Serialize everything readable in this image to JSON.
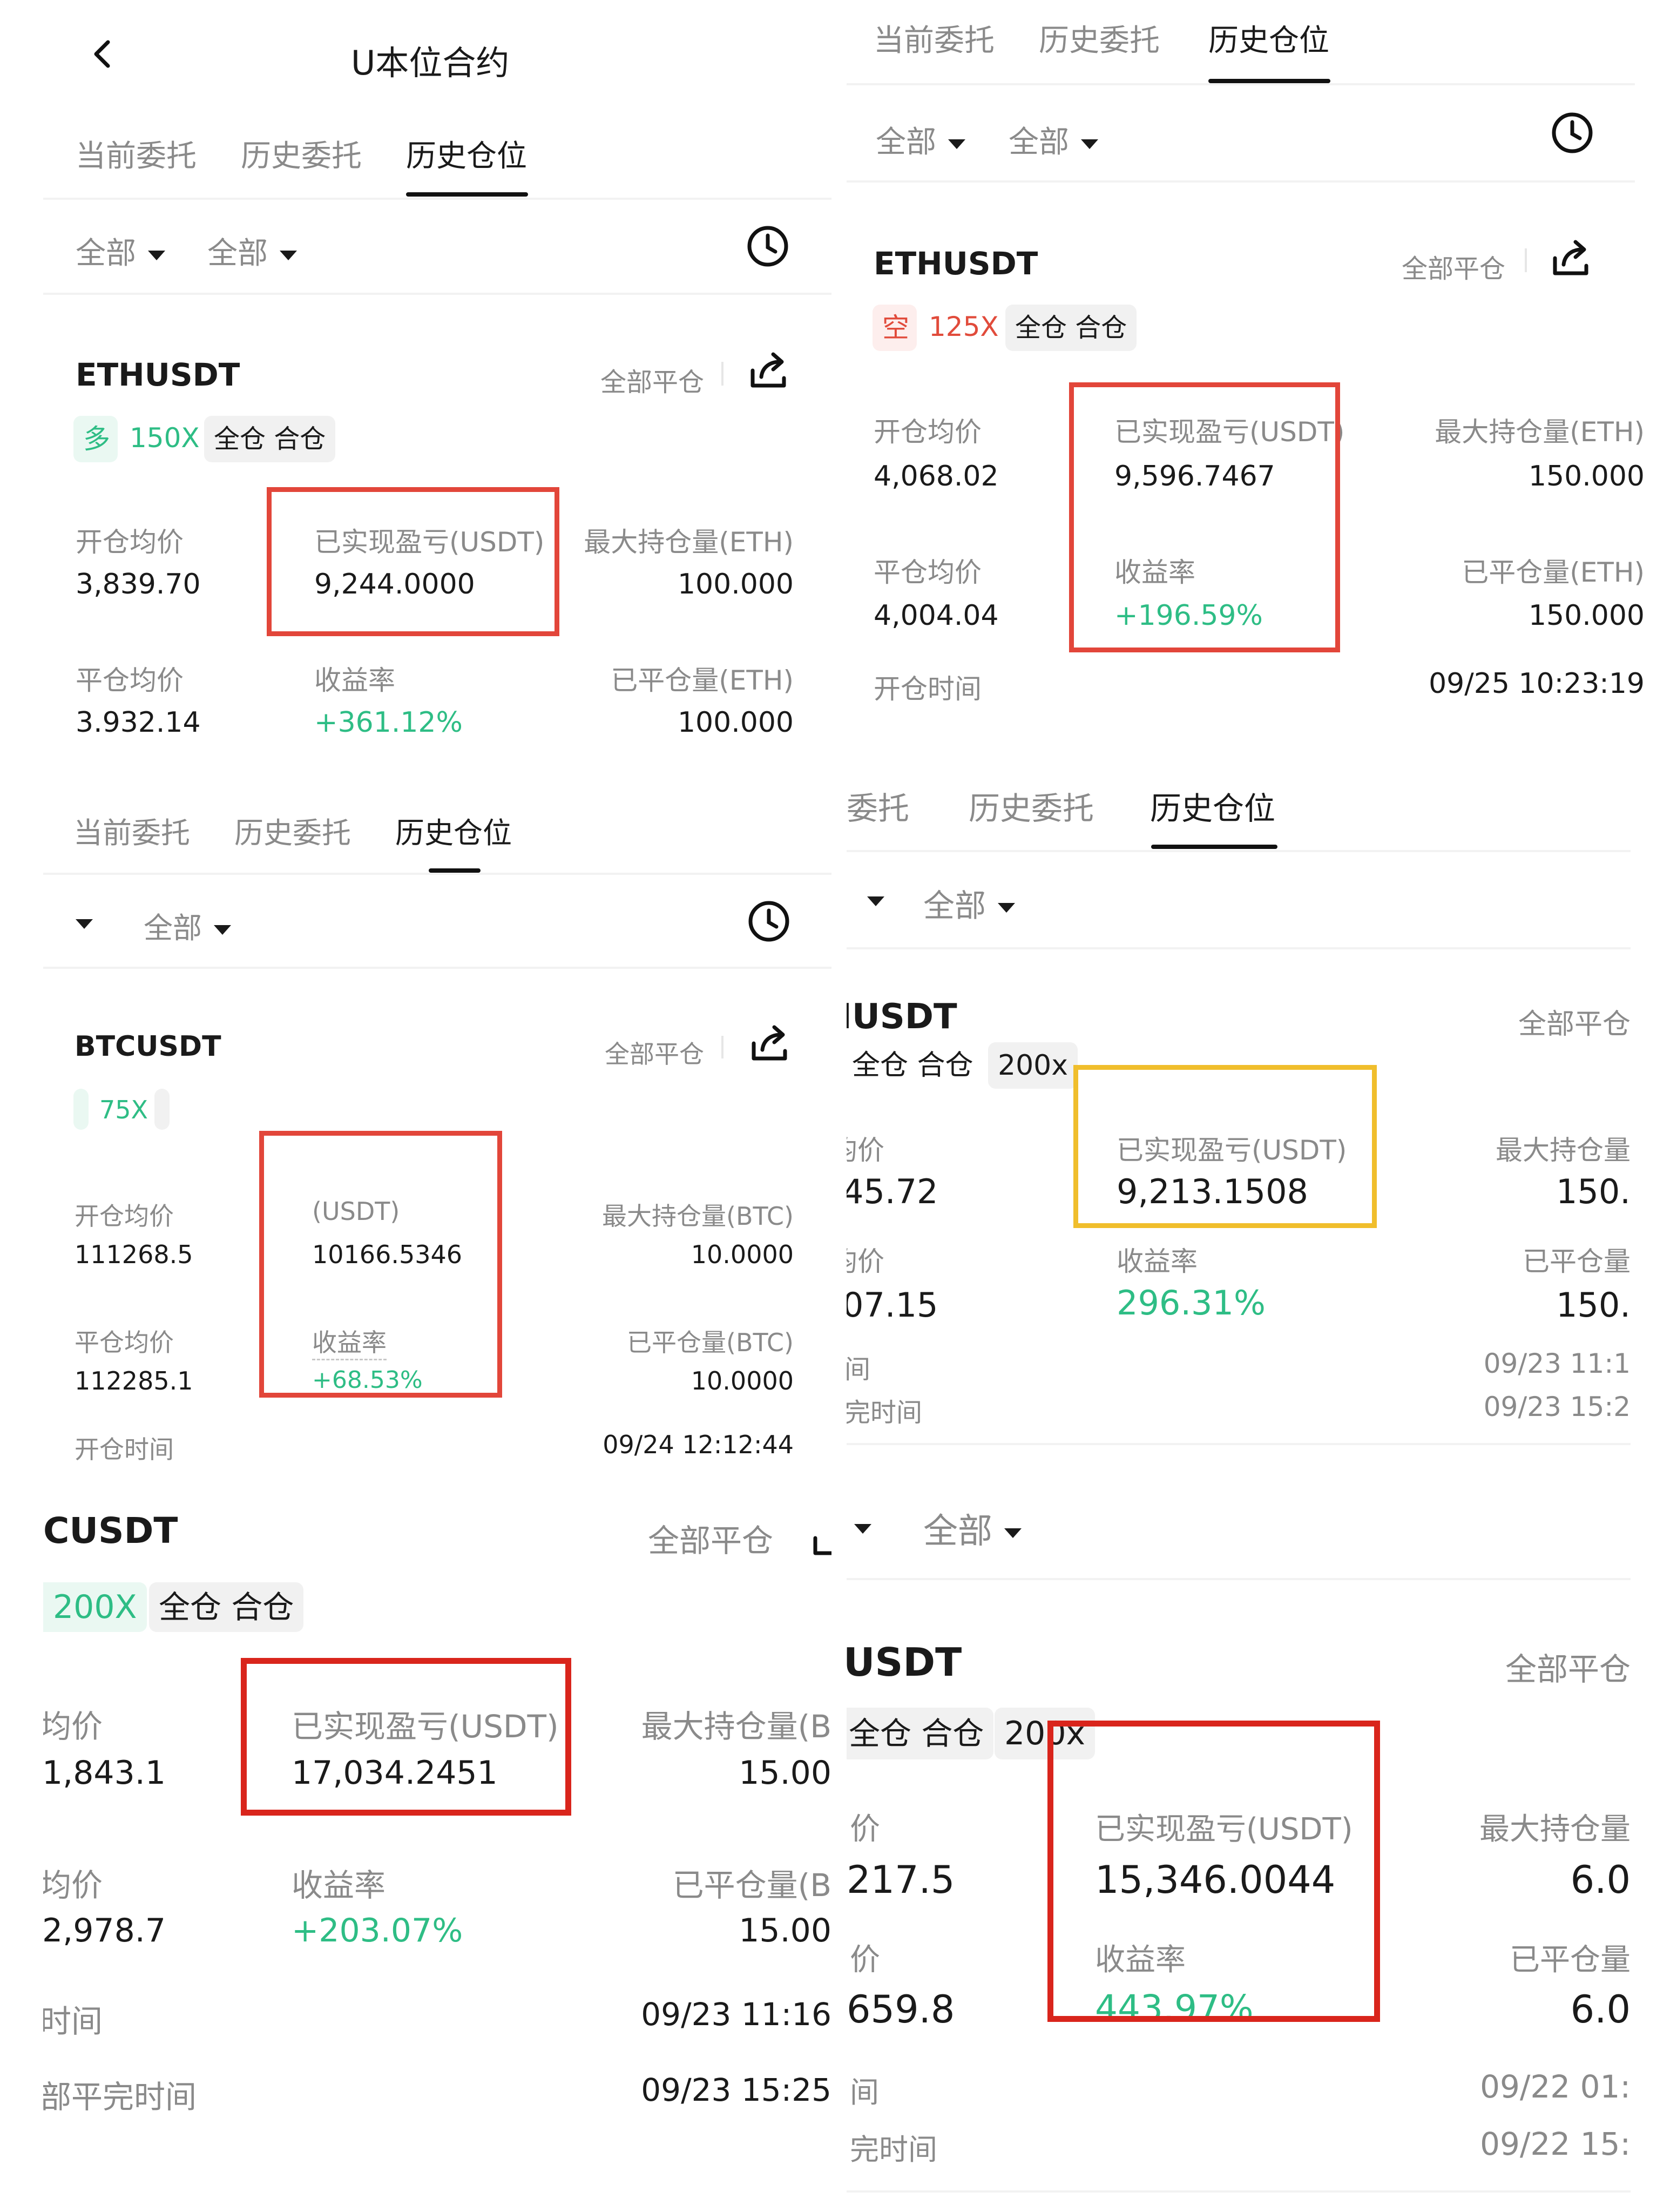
{
  "p1": {
    "title": "U本位合约",
    "tabs": [
      "当前委托",
      "历史委托",
      "历史仓位"
    ],
    "filter1": "全部",
    "filter2": "全部",
    "symbol": "ETHUSDT",
    "close_all": "全部平仓",
    "side": "多",
    "leverage": "150X",
    "margin": "全仓 合仓",
    "open_avg_label": "开仓均价",
    "open_avg": "3,839.70",
    "pnl_label": "已实现盈亏(USDT)",
    "pnl": "9,244.0000",
    "max_hold_label": "最大持仓量(ETH)",
    "max_hold": "100.000",
    "close_avg_label": "平仓均价",
    "close_avg": "3.932.14",
    "roi_label": "收益率",
    "roi": "+361.12%",
    "closed_label": "已平仓量(ETH)",
    "closed": "100.000"
  },
  "p2": {
    "tabs_partial": "当前委托",
    "tabs": [
      "历史委托",
      "历史仓位"
    ],
    "filter1": "全部",
    "filter2": "全部",
    "symbol": "ETHUSDT",
    "close_all": "全部平仓",
    "side": "空",
    "leverage": "125X",
    "margin": "全仓 合仓",
    "open_avg_label": "开仓均价",
    "open_avg": "4,068.02",
    "pnl_label": "已实现盈亏(USDT)",
    "pnl": "9,596.7467",
    "max_hold_label": "最大持仓量(ETH)",
    "max_hold": "150.000",
    "close_avg_label": "平仓均价",
    "close_avg": "4,004.04",
    "roi_label": "收益率",
    "roi": "+196.59%",
    "closed_label": "已平仓量(ETH)",
    "closed": "150.000",
    "open_time_label": "开仓时间",
    "open_time": "09/25 10:23:19"
  },
  "p3": {
    "tabs": [
      "当前委托",
      "历史委托",
      "历史仓位"
    ],
    "filter2": "全部",
    "symbol": "BTCUSDT",
    "close_all": "全部平仓",
    "leverage": "75X",
    "open_avg_label": "开仓均价",
    "open_avg": "111268.5",
    "pnl_label": "(USDT)",
    "pnl": "10166.5346",
    "max_hold_label": "最大持仓量(BTC)",
    "max_hold": "10.0000",
    "close_avg_label": "平仓均价",
    "close_avg": "112285.1",
    "roi_label": "收益率",
    "roi": "+68.53%",
    "closed_label": "已平仓量(BTC)",
    "closed": "10.0000",
    "open_time_label": "开仓时间",
    "open_time": "09/24 12:12:44"
  },
  "p4": {
    "tabs": [
      "委托",
      "历史委托",
      "历史仓位"
    ],
    "filter2": "全部",
    "symbol": "IUSDT",
    "close_all": "全部平仓",
    "margin": "全仓 合仓",
    "leverage": "200x",
    "open_avg_label": "均价",
    "open_avg": "45.72",
    "pnl_label": "已实现盈亏(USDT)",
    "pnl": "9,213.1508",
    "max_hold_label": "最大持仓量",
    "max_hold": "150.",
    "close_avg_label": "均价",
    "close_avg": "07.15",
    "roi_label": "收益率",
    "roi": "296.31%",
    "closed_label": "已平仓量",
    "closed": "150.",
    "open_time_label": "间",
    "open_time": "09/23 11:1",
    "close_time_label": "完时间",
    "close_time": "09/23 15:2"
  },
  "p5": {
    "symbol": "CUSDT",
    "close_all": "全部平仓",
    "leverage": "200X",
    "margin": "全仓 合仓",
    "open_avg_label": "均价",
    "open_avg": "1,843.1",
    "pnl_label": "已实现盈亏(USDT)",
    "pnl": "17,034.2451",
    "max_hold_label": "最大持仓量(B",
    "max_hold": "15.00",
    "close_avg_label": "均价",
    "close_avg": "2,978.7",
    "roi_label": "收益率",
    "roi": "+203.07%",
    "closed_label": "已平仓量(B",
    "closed": "15.00",
    "open_time_label": "时间",
    "open_time": "09/23 11:16",
    "close_time_label": "部平完时间",
    "close_time": "09/23 15:25"
  },
  "p6": {
    "filter2": "全部",
    "symbol": "USDT",
    "close_all": "全部平仓",
    "margin": "全仓 合仓",
    "leverage": "200x",
    "open_avg_label": "价",
    "open_avg": "217.5",
    "pnl_label": "已实现盈亏(USDT)",
    "pnl": "15,346.0044",
    "max_hold_label": "最大持仓量",
    "max_hold": "6.0",
    "close_avg_label": "价",
    "close_avg": "659.8",
    "roi_label": "收益率",
    "roi": "443.97%",
    "closed_label": "已平仓量",
    "closed": "6.0",
    "open_time_label": "间",
    "open_time": "09/22 01:",
    "close_time_label": "完时间",
    "close_time": "09/22 15:"
  },
  "colors": {
    "profit_green": "#2ebd85",
    "short_red": "#e14b3b",
    "highlight_red": "#e2463a",
    "highlight_yellow": "#f0be2c",
    "highlight_darkred": "#d9251c"
  },
  "icons": [
    "back-arrow-icon",
    "clock-icon",
    "share-icon",
    "caret-down-icon"
  ]
}
